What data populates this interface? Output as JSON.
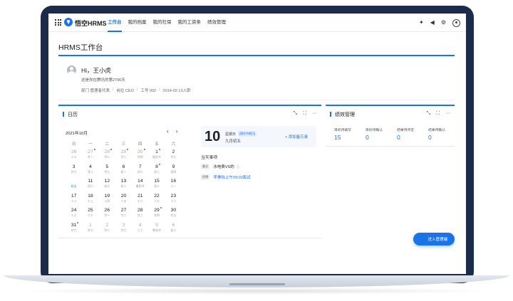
{
  "app": {
    "brand": "悟空HRMS",
    "nav": [
      "工作台",
      "我的档案",
      "我的社保",
      "我的工资条",
      "绩效管理"
    ],
    "active_nav": 0,
    "icons": [
      "push-pin-icon",
      "speaker-icon",
      "gear-icon",
      "user-avatar-icon"
    ]
  },
  "page": {
    "title": "HRMS工作台"
  },
  "profile": {
    "greeting": "Hi，王小虎",
    "welcome": "这是你在腾讯的第2796天",
    "department": "部门 管理者代表",
    "position": "岗位 CEO",
    "job_no": "工号 002",
    "join_info": "2014-02-13入职"
  },
  "calendar": {
    "title": "日历",
    "month_label": "2021年10月",
    "prev": "‹",
    "next": "›",
    "weekdays": [
      "日",
      "一",
      "二",
      "三",
      "四",
      "五",
      "六"
    ],
    "weeks": [
      [
        {
          "d": "26",
          "l": "二十",
          "out": true
        },
        {
          "d": "27",
          "l": "廿一",
          "out": true,
          "dot": true
        },
        {
          "d": "28",
          "l": "廿二",
          "out": true,
          "dot": true
        },
        {
          "d": "29",
          "l": "廿三",
          "out": true,
          "dot": true
        },
        {
          "d": "30",
          "l": "廿四",
          "out": true,
          "dot": true
        },
        {
          "d": "1",
          "l": "国庆节",
          "dot": true
        },
        {
          "d": "2",
          "l": "廿七"
        }
      ],
      [
        {
          "d": "3",
          "l": "廿七"
        },
        {
          "d": "4",
          "l": "廿八"
        },
        {
          "d": "5",
          "l": "廿九"
        },
        {
          "d": "6",
          "l": "初一"
        },
        {
          "d": "7",
          "l": "初二"
        },
        {
          "d": "8",
          "l": "初三",
          "dot": true
        },
        {
          "d": "9",
          "l": "初四"
        }
      ],
      [
        {
          "d": "10",
          "l": "初五",
          "today": true
        },
        {
          "d": "11",
          "l": "初六"
        },
        {
          "d": "12",
          "l": "初七"
        },
        {
          "d": "13",
          "l": "初八"
        },
        {
          "d": "14",
          "l": "重阳节"
        },
        {
          "d": "15",
          "l": "初十"
        },
        {
          "d": "16",
          "l": "十一"
        }
      ],
      [
        {
          "d": "17",
          "l": "十二"
        },
        {
          "d": "18",
          "l": "十三"
        },
        {
          "d": "19",
          "l": "十四"
        },
        {
          "d": "20",
          "l": "十五"
        },
        {
          "d": "21",
          "l": "十六"
        },
        {
          "d": "22",
          "l": "十七"
        },
        {
          "d": "23",
          "l": "十八"
        }
      ],
      [
        {
          "d": "24",
          "l": "十九"
        },
        {
          "d": "25",
          "l": "二十"
        },
        {
          "d": "26",
          "l": "廿一"
        },
        {
          "d": "27",
          "l": "廿二"
        },
        {
          "d": "28",
          "l": "廿三"
        },
        {
          "d": "29",
          "l": "廿四",
          "dot": true
        },
        {
          "d": "30",
          "l": "廿五"
        }
      ],
      [
        {
          "d": "31",
          "l": "廿六",
          "dot": true
        },
        {
          "d": "1",
          "l": "廿七",
          "out": true
        },
        {
          "d": "2",
          "l": "廿八",
          "out": true
        },
        {
          "d": "3",
          "l": "廿九",
          "out": true
        },
        {
          "d": "4",
          "l": "三十",
          "out": true
        },
        {
          "d": "5",
          "l": "寒衣节",
          "out": true
        },
        {
          "d": "6",
          "l": "初二",
          "out": true
        }
      ]
    ],
    "selected": {
      "day": "10",
      "weekday": "星期日",
      "badge": "[国庆节假日]",
      "lunar": "九月初五",
      "add_memo": "+ 添加备忘录"
    },
    "today_label": "当天事项",
    "events": [
      {
        "tag": "备忘",
        "text": "水电费VS的",
        "info": "ⓘ",
        "link": false
      },
      {
        "tag": "招聘",
        "text": "李秉陆上午09:00面试",
        "info": "",
        "link": true
      }
    ]
  },
  "performance": {
    "title": "绩效管理",
    "stats": [
      {
        "label": "目标待填写",
        "value": "15"
      },
      {
        "label": "目标待确认",
        "value": "0"
      },
      {
        "label": "结果待评定",
        "value": "0"
      },
      {
        "label": "结果待确认",
        "value": "0"
      }
    ]
  },
  "admin_button": {
    "label": "进入管理端"
  },
  "colors": {
    "accent": "#1a73e8",
    "frame": "#1d2b4a"
  }
}
